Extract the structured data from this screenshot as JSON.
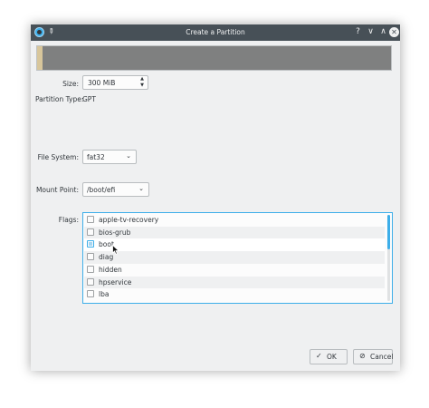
{
  "window": {
    "title": "Create a Partition",
    "icons": {
      "app": "partition-manager-icon",
      "pin": "pin-icon",
      "help": "help-icon",
      "minimize": "minimize-icon",
      "maximize": "maximize-icon",
      "close": "close-icon"
    },
    "help_glyph": "?",
    "minimize_glyph": "∨",
    "maximize_glyph": "∧",
    "close_glyph": "✕"
  },
  "form": {
    "size_label": "Size:",
    "size_value": "300 MiB",
    "partition_type_label": "Partition Type:",
    "partition_type_value": "GPT",
    "file_system_label": "File System:",
    "file_system_value": "fat32",
    "mount_point_label": "Mount Point:",
    "mount_point_value": "/boot/efi",
    "flags_label": "Flags:"
  },
  "flags": [
    {
      "label": "apple-tv-recovery",
      "checked": false
    },
    {
      "label": "bios-grub",
      "checked": false
    },
    {
      "label": "boot",
      "checked": false,
      "hovered": true
    },
    {
      "label": "diag",
      "checked": false
    },
    {
      "label": "hidden",
      "checked": false
    },
    {
      "label": "hpservice",
      "checked": false
    },
    {
      "label": "lba",
      "checked": false
    }
  ],
  "buttons": {
    "ok_label": "OK",
    "ok_glyph": "✓",
    "cancel_label": "Cancel",
    "cancel_glyph": "⊘"
  },
  "colors": {
    "titlebar": "#475057",
    "accent": "#3daee9",
    "partition_bar": "#7f8080",
    "partition_used": "#d8c69b"
  }
}
